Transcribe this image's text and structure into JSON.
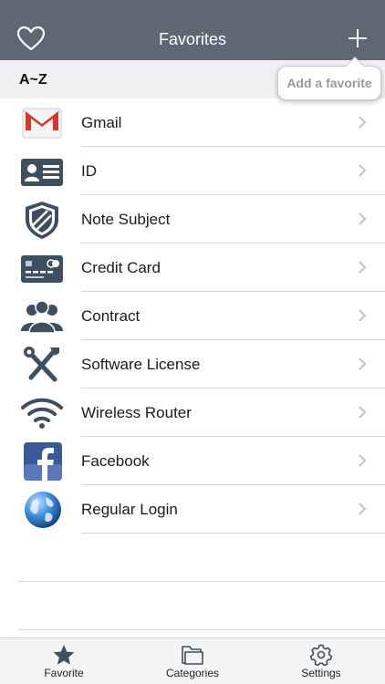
{
  "navbar": {
    "title": "Favorites",
    "left_icon": "heart-outline-icon",
    "right_icon": "plus-icon"
  },
  "tooltip": {
    "text": "Add a favorite"
  },
  "section": {
    "label": "A~Z"
  },
  "items": [
    {
      "label": "Gmail",
      "icon": "gmail-icon"
    },
    {
      "label": "ID",
      "icon": "id-card-icon"
    },
    {
      "label": "Note Subject",
      "icon": "shield-icon"
    },
    {
      "label": "Credit Card",
      "icon": "credit-card-icon"
    },
    {
      "label": "Contract",
      "icon": "people-icon"
    },
    {
      "label": "Software License",
      "icon": "tools-icon"
    },
    {
      "label": "Wireless Router",
      "icon": "wifi-icon"
    },
    {
      "label": "Facebook",
      "icon": "facebook-icon"
    },
    {
      "label": "Regular Login",
      "icon": "globe-icon"
    }
  ],
  "tabbar": {
    "tabs": [
      {
        "label": "Favorite",
        "icon": "star-icon",
        "selected": true
      },
      {
        "label": "Categories",
        "icon": "folder-icon",
        "selected": false
      },
      {
        "label": "Settings",
        "icon": "gear-icon",
        "selected": false
      }
    ]
  },
  "colors": {
    "navbar": "#5d6874",
    "section_bg": "#f1f1f3",
    "tabbar_bg": "#f4f4f5",
    "divider": "#d7d7da"
  }
}
